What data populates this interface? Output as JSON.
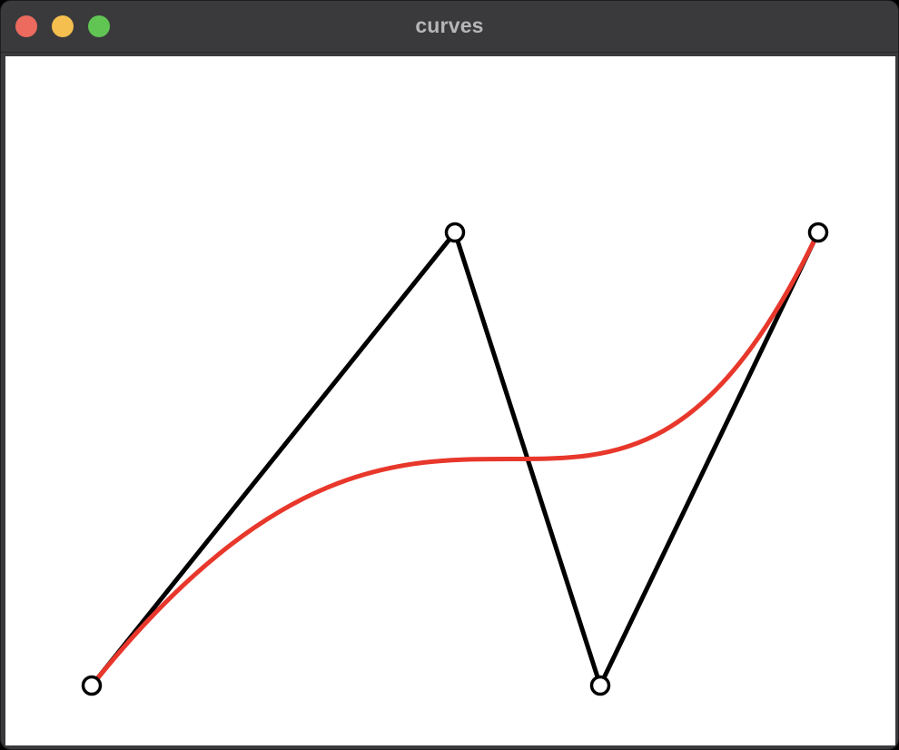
{
  "window": {
    "title": "curves",
    "traffic_lights": {
      "close_color": "#ed6a5e",
      "minimize_color": "#f5bf4f",
      "zoom_color": "#61c554"
    }
  },
  "colors": {
    "control_polygon": "#000000",
    "bezier_curve": "#e8372b",
    "control_point_fill": "#ffffff",
    "control_point_stroke": "#000000"
  },
  "icons": {
    "control_point": "hollow-circle-handle"
  },
  "curve": {
    "type": "cubic-bezier",
    "control_point_count": 4
  }
}
